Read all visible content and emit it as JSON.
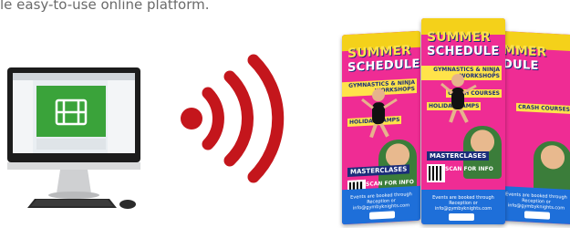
{
  "tagline": "le easy-to-use online platform.",
  "poster": {
    "title_line1": "SUMMER",
    "title_line2": "SCHEDULE",
    "side_title_line1": "MMER",
    "side_title_line2": "DULE",
    "tag_workshops": "GYMNASTICS & NINJA WORKSHOPS",
    "tag_courses": "CRASH COURSES",
    "tag_camps": "HOLIDAY CAMPS",
    "masterclass": "MASTERCLASES",
    "scan": "SCAN FOR INFO",
    "bottom": "Events are booked through Reception or info@gymbyknights.com"
  },
  "colors": {
    "poster_pink": "#ef2c94",
    "poster_yellow": "#f4d11a",
    "poster_navy": "#1b2d7a",
    "poster_blue": "#1e6fd9",
    "wifi_red": "#c4161c",
    "screen_green": "#3aa33a"
  },
  "icons": {
    "computer": "desktop-computer-icon",
    "wifi": "wireless-signal-icon",
    "film": "film-icon"
  }
}
